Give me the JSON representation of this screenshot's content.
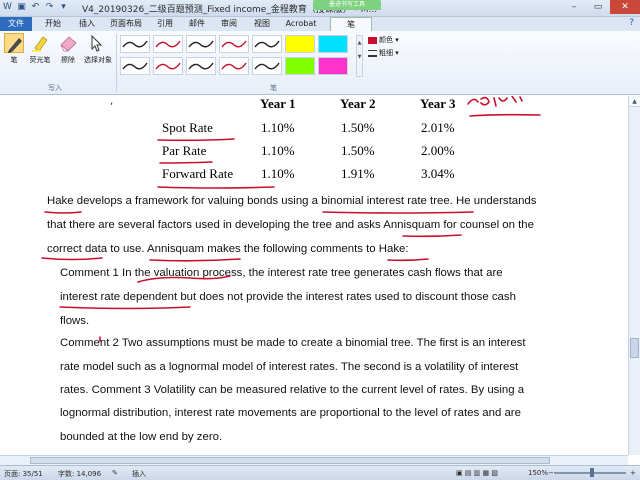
{
  "window": {
    "title": "V4_20190326_二级百题预测_Fixed income_金程教育（授课版） - M...",
    "context_group": "墨迹书写工具"
  },
  "tabs": [
    "文件",
    "开始",
    "插入",
    "页面布局",
    "引用",
    "邮件",
    "审阅",
    "视图",
    "Acrobat",
    "笔"
  ],
  "ribbon": {
    "tools": [
      {
        "label": "笔",
        "icon": "pen-icon"
      },
      {
        "label": "荧光笔",
        "icon": "highlighter-icon"
      },
      {
        "label": "擦除",
        "icon": "eraser-icon"
      },
      {
        "label": "选择对象",
        "icon": "cursor-icon"
      }
    ],
    "group_write": "写入",
    "group_pens": "笔",
    "color_label": "颜色",
    "weight_label": "粗细",
    "pen_swatch_colors": [
      "#222222",
      "#c8102e",
      "#222222",
      "#c8102e",
      "#222222",
      "#ffff00",
      "#00e0ff",
      "#222222",
      "#c8102e",
      "#222222",
      "#c8102e",
      "#222222",
      "#7fff00",
      "#ff33cc"
    ]
  },
  "table": {
    "headers": [
      "Year 1",
      "Year 2",
      "Year 3"
    ],
    "rows": [
      {
        "label": "Spot Rate",
        "values": [
          "1.10%",
          "1.50%",
          "2.01%"
        ]
      },
      {
        "label": "Par Rate",
        "values": [
          "1.10%",
          "1.50%",
          "2.00%"
        ]
      },
      {
        "label": "Forward Rate",
        "values": [
          "1.10%",
          "1.91%",
          "3.04%"
        ]
      }
    ]
  },
  "body": [
    "Hake develops a framework for valuing bonds using a binomial interest rate tree. He understands",
    "that there are several factors used in developing the tree and asks Annisquam for counsel on the",
    "correct data to use. Annisquam makes the following comments to Hake:",
    "Comment 1 In the valuation process, the interest rate tree generates cash flows that are",
    "interest rate dependent but does not provide the interest rates used to discount those cash",
    "flows.",
    "Comment 2 Two assumptions must be made to create a binomial tree. The first is an interest",
    "rate model such as a lognormal model of interest rates. The second is a volatility of interest",
    "rates. Comment 3 Volatility can be measured relative to the current level of rates. By using a",
    "lognormal distribution, interest rate movements are proportional to the level of rates and are",
    "bounded at the low end by zero."
  ],
  "status": {
    "page": "页面: 35/51",
    "words": "字数: 14,096",
    "insert": "插入",
    "zoom": "150%"
  },
  "colors": {
    "ink": "#c8102e",
    "file_tab": "#2e6cc0",
    "context_tab": "#7ed17e"
  }
}
